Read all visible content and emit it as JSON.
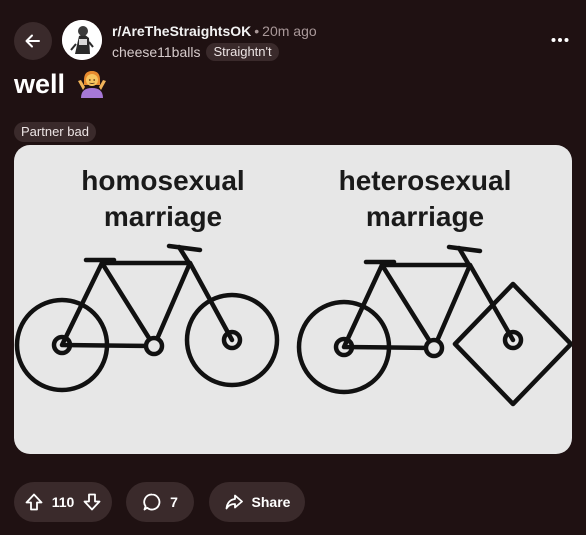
{
  "header": {
    "subreddit": "r/AreTheStraightsOK",
    "separator": "•",
    "time_ago": "20m ago",
    "username": "cheese11balls",
    "user_flair": "Straightn't"
  },
  "post": {
    "title": "well",
    "title_emoji_icon": "person-shrugging-emoji-icon",
    "flair": "Partner bad",
    "image": {
      "left_label_line1": "homosexual",
      "left_label_line2": "marriage",
      "right_label_line1": "heterosexual",
      "right_label_line2": "marriage"
    }
  },
  "actions": {
    "votes": "110",
    "comments": "7",
    "share_label": "Share"
  },
  "colors": {
    "background": "#1f1112",
    "pill": "#3a2a2b",
    "muted_text": "#a99899",
    "image_bg": "#e7e7e7"
  }
}
